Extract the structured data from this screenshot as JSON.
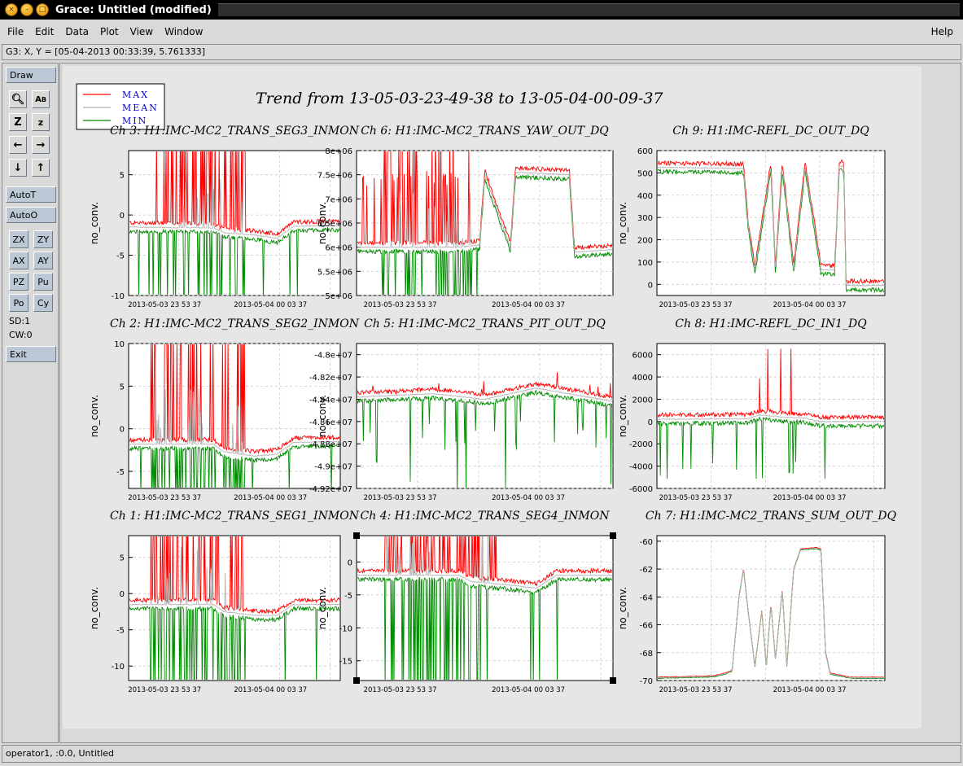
{
  "window": {
    "title": "Grace: Untitled (modified)"
  },
  "menu": {
    "items": [
      "File",
      "Edit",
      "Data",
      "Plot",
      "View",
      "Window"
    ],
    "help": "Help"
  },
  "locator": {
    "text": "G3: X, Y = [05-04-2013 00:33:39, 5.761333]"
  },
  "toolbar": {
    "draw": "Draw",
    "icons": [
      [
        "zoom-icon",
        "text-icon"
      ],
      [
        "zoom-in-icon",
        "zoom-out-icon"
      ],
      [
        "left-arrow-icon",
        "right-arrow-icon"
      ],
      [
        "down-arrow-icon",
        "up-arrow-icon"
      ]
    ],
    "autot": "AutoT",
    "autoo": "AutoO",
    "zx": "ZX",
    "zy": "ZY",
    "ax": "AX",
    "ay": "AY",
    "pz": "PZ",
    "pu": "Pu",
    "po": "Po",
    "cy": "Cy",
    "sd": "SD:1",
    "cw": "CW:0",
    "exit": "Exit"
  },
  "status": {
    "text": "operator1, :0.0, Untitled"
  },
  "colors": {
    "max": "#ff0000",
    "mean": "#b4b4b4",
    "min": "#008c00",
    "legend_text": "#0000cc"
  },
  "legend": [
    "MAX",
    "MEAN",
    "MIN"
  ],
  "main_title": "Trend from 13-05-03-23-49-38 to 13-05-04-00-09-37",
  "chart_data": [
    {
      "id": "ch3",
      "type": "line",
      "title": "Ch 3: H1:IMC-MC2_TRANS_SEG3_INMON",
      "ylabel": "no_conv.",
      "ylim": [
        -10,
        8
      ],
      "yticks": [
        5,
        0,
        -5,
        -10
      ],
      "ytick_labels": [
        "5",
        "0",
        "-5",
        "-10"
      ],
      "xticks": [
        "2013-05-03 23 53 37",
        "2013-05-04 00 03 37"
      ],
      "mean_level": [
        [
          0,
          -1.5
        ],
        [
          0.4,
          -1.6
        ],
        [
          0.45,
          -2.2
        ],
        [
          0.6,
          -2.5
        ],
        [
          0.7,
          -2.9
        ],
        [
          0.78,
          -1.4
        ],
        [
          1,
          -1.3
        ]
      ],
      "bursts": [
        [
          0.1,
          0.55,
          0.9
        ]
      ],
      "selected": false
    },
    {
      "id": "ch6",
      "type": "line",
      "title": "Ch 6: H1:IMC-MC2_TRANS_YAW_OUT_DQ",
      "ylabel": "no_conv.",
      "ylim": [
        5000000,
        8000000
      ],
      "yticks": [
        8000000,
        7500000,
        7000000,
        6500000,
        6000000,
        5500000,
        5000000
      ],
      "ytick_labels": [
        "8e+06",
        "7.5e+06",
        "7e+06",
        "6.5e+06",
        "6e+06",
        "5.5e+06",
        "5e+06"
      ],
      "xticks": [
        "2013-05-03 23 53 37",
        "2013-05-04 00 03 37"
      ],
      "mean_level": [
        [
          0,
          6000000
        ],
        [
          0.4,
          6000000
        ],
        [
          0.48,
          6050000
        ],
        [
          0.5,
          7500000
        ],
        [
          0.6,
          6000000
        ],
        [
          0.62,
          7550000
        ],
        [
          0.83,
          7500000
        ],
        [
          0.85,
          5900000
        ],
        [
          1,
          5950000
        ]
      ],
      "bursts": [
        [
          0.1,
          0.45,
          0.7
        ]
      ],
      "selected": false
    },
    {
      "id": "ch9",
      "type": "line",
      "title": "Ch 9: H1:IMC-REFL_DC_OUT_DQ",
      "ylabel": "no_conv.",
      "ylim": [
        -50,
        600
      ],
      "yticks": [
        600,
        500,
        400,
        300,
        200,
        100,
        0
      ],
      "ytick_labels": [
        "600",
        "500",
        "400",
        "300",
        "200",
        "100",
        "0"
      ],
      "xticks": [
        "2013-05-03 23 53 37",
        "2013-05-04 00 03 37"
      ],
      "mean_level": [
        [
          0,
          525
        ],
        [
          0.38,
          520
        ],
        [
          0.4,
          270
        ],
        [
          0.43,
          65
        ],
        [
          0.5,
          530
        ],
        [
          0.52,
          65
        ],
        [
          0.55,
          530
        ],
        [
          0.6,
          70
        ],
        [
          0.65,
          530
        ],
        [
          0.72,
          65
        ],
        [
          0.78,
          65
        ],
        [
          0.8,
          530
        ],
        [
          0.82,
          530
        ],
        [
          0.83,
          -5
        ],
        [
          1,
          -5
        ]
      ],
      "bursts": [],
      "selected": false
    },
    {
      "id": "ch2",
      "type": "line",
      "title": "Ch 2: H1:IMC-MC2_TRANS_SEG2_INMON",
      "ylabel": "no_conv.",
      "ylim": [
        -7,
        10
      ],
      "yticks": [
        10,
        5,
        0,
        -5
      ],
      "ytick_labels": [
        "10",
        "5",
        "0",
        "-5"
      ],
      "xticks": [
        "2013-05-03 23 53 37",
        "2013-05-04 00 03 37"
      ],
      "mean_level": [
        [
          0,
          -1.8
        ],
        [
          0.4,
          -1.8
        ],
        [
          0.45,
          -2.7
        ],
        [
          0.6,
          -3.2
        ],
        [
          0.7,
          -3.0
        ],
        [
          0.78,
          -1.6
        ],
        [
          1,
          -1.5
        ]
      ],
      "bursts": [
        [
          0.1,
          0.55,
          1
        ]
      ],
      "selected": false
    },
    {
      "id": "ch5",
      "type": "line",
      "title": "Ch 5: H1:IMC-MC2_TRANS_PIT_OUT_DQ",
      "ylabel": "no_conv.",
      "ylim": [
        -49200000,
        -47900000
      ],
      "yticks": [
        -48000000,
        -48200000,
        -48400000,
        -48600000,
        -48800000,
        -49000000,
        -49200000
      ],
      "ytick_labels": [
        "-4.8e+07",
        "-4.82e+07",
        "-4.84e+07",
        "-4.86e+07",
        "-4.88e+07",
        "-4.9e+07",
        "-4.92e+07"
      ],
      "xticks": [
        "2013-05-03 23 53 37",
        "2013-05-04 00 03 37"
      ],
      "mean_level": [
        [
          0,
          -48380000
        ],
        [
          0.3,
          -48350000
        ],
        [
          0.5,
          -48400000
        ],
        [
          0.7,
          -48300000
        ],
        [
          1,
          -48420000
        ]
      ],
      "bursts": [],
      "selected": false
    },
    {
      "id": "ch8",
      "type": "line",
      "title": "Ch 8: H1:IMC-REFL_DC_IN1_DQ",
      "ylabel": "no_conv.",
      "ylim": [
        -6000,
        7000
      ],
      "yticks": [
        6000,
        4000,
        2000,
        0,
        -2000,
        -4000,
        -6000
      ],
      "ytick_labels": [
        "6000",
        "4000",
        "2000",
        "0",
        "-2000",
        "-4000",
        "-6000"
      ],
      "xticks": [
        "2013-05-03 23 53 37",
        "2013-05-04 00 03 37"
      ],
      "mean_level": [
        [
          0,
          200
        ],
        [
          0.4,
          250
        ],
        [
          0.45,
          600
        ],
        [
          0.55,
          400
        ],
        [
          0.65,
          300
        ],
        [
          0.72,
          0
        ],
        [
          0.82,
          0
        ],
        [
          1,
          0
        ]
      ],
      "bursts": [],
      "selected": false
    },
    {
      "id": "ch1",
      "type": "line",
      "title": "Ch 1: H1:IMC-MC2_TRANS_SEG1_INMON",
      "ylabel": "no_conv.",
      "ylim": [
        -12,
        8
      ],
      "yticks": [
        5,
        0,
        -5,
        -10
      ],
      "ytick_labels": [
        "5",
        "0",
        "-5",
        "-10"
      ],
      "xticks": [
        "2013-05-03 23 53 37",
        "2013-05-04 00 03 37"
      ],
      "mean_level": [
        [
          0,
          -1.5
        ],
        [
          0.4,
          -1.5
        ],
        [
          0.45,
          -2.5
        ],
        [
          0.6,
          -3.0
        ],
        [
          0.7,
          -3.0
        ],
        [
          0.78,
          -1.5
        ],
        [
          1,
          -1.5
        ]
      ],
      "bursts": [
        [
          0.1,
          0.55,
          1
        ]
      ],
      "selected": false
    },
    {
      "id": "ch4",
      "type": "line",
      "title": "Ch 4: H1:IMC-MC2_TRANS_SEG4_INMON",
      "ylabel": "no_conv.",
      "ylim": [
        -18,
        4
      ],
      "yticks": [
        0,
        -5,
        -10,
        -15
      ],
      "ytick_labels": [
        "0",
        "-5",
        "-10",
        "-15"
      ],
      "xticks": [
        "2013-05-03 23 53 37",
        "2013-05-04 00 03 37"
      ],
      "mean_level": [
        [
          0,
          -2
        ],
        [
          0.4,
          -2
        ],
        [
          0.45,
          -3
        ],
        [
          0.6,
          -3.5
        ],
        [
          0.7,
          -4
        ],
        [
          0.78,
          -2
        ],
        [
          1,
          -2
        ]
      ],
      "bursts": [
        [
          0.1,
          0.55,
          1
        ]
      ],
      "selected": true
    },
    {
      "id": "ch7",
      "type": "line",
      "title": "Ch 7: H1:IMC-MC2_TRANS_SUM_OUT_DQ",
      "ylabel": "no_conv.",
      "ylim": [
        -70,
        -59.6
      ],
      "yticks": [
        -60,
        -62,
        -64,
        -66,
        -68,
        -70
      ],
      "ytick_labels": [
        "-60",
        "-62",
        "-64",
        "-66",
        "-68",
        "-70"
      ],
      "xticks": [
        "2013-05-03 23 53 37",
        "2013-05-04 00 03 37"
      ],
      "mean_level": [
        [
          0,
          -69.8
        ],
        [
          0.25,
          -69.7
        ],
        [
          0.3,
          -69.5
        ],
        [
          0.33,
          -69.3
        ],
        [
          0.36,
          -64
        ],
        [
          0.38,
          -62
        ],
        [
          0.4,
          -65
        ],
        [
          0.43,
          -69
        ],
        [
          0.46,
          -65
        ],
        [
          0.48,
          -69
        ],
        [
          0.5,
          -64.5
        ],
        [
          0.52,
          -68.5
        ],
        [
          0.55,
          -63.5
        ],
        [
          0.57,
          -69
        ],
        [
          0.6,
          -62
        ],
        [
          0.63,
          -60.6
        ],
        [
          0.7,
          -60.5
        ],
        [
          0.72,
          -60.6
        ],
        [
          0.74,
          -68
        ],
        [
          0.76,
          -69.5
        ],
        [
          0.85,
          -69.8
        ],
        [
          1,
          -69.8
        ]
      ],
      "bursts": [],
      "selected": false
    }
  ]
}
